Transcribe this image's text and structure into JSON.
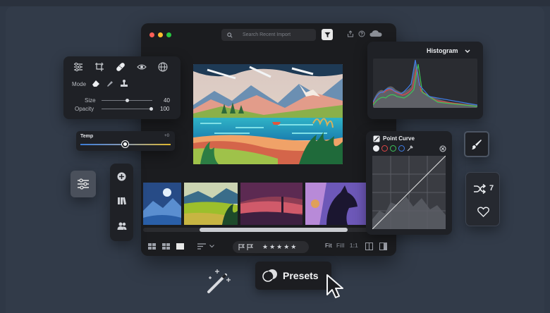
{
  "window": {
    "search_placeholder": "Search Recent Import"
  },
  "tools_panel": {
    "mode_label": "Mode",
    "size_label": "Size",
    "size_value": "40",
    "size_level": 0.5,
    "opacity_label": "Opacity",
    "opacity_value": "100",
    "opacity_level": 1.0
  },
  "temp_panel": {
    "label": "Temp",
    "value": "+0",
    "level": 0.5
  },
  "histogram": {
    "title": "Histogram"
  },
  "point_curve": {
    "title": "Point Curve",
    "channels": [
      "white",
      "red",
      "green",
      "blue"
    ]
  },
  "bottombar": {
    "fit_label": "Fit",
    "fill_label": "Fill",
    "ratio_label": "1:1",
    "stars": "★★★★★"
  },
  "share_panel": {
    "count": "7"
  },
  "presets": {
    "label": "Presets"
  },
  "colors": {
    "background": "#2f3846",
    "panel": "#1f2126",
    "accent_temp_cool": "#3b7cd6",
    "accent_temp_warm": "#e0b82c"
  },
  "icons": [
    "search-icon",
    "filter-icon",
    "share-icon",
    "help-icon",
    "cloud-icon",
    "sliders-icon",
    "transform-icon",
    "healing-icon",
    "eye-icon",
    "globe-icon",
    "eraser-icon",
    "brush-icon",
    "stamp-icon",
    "plus-icon",
    "library-icon",
    "people-icon",
    "shuffle-icon",
    "heart-icon",
    "magic-wand-icon",
    "cursor-icon"
  ]
}
